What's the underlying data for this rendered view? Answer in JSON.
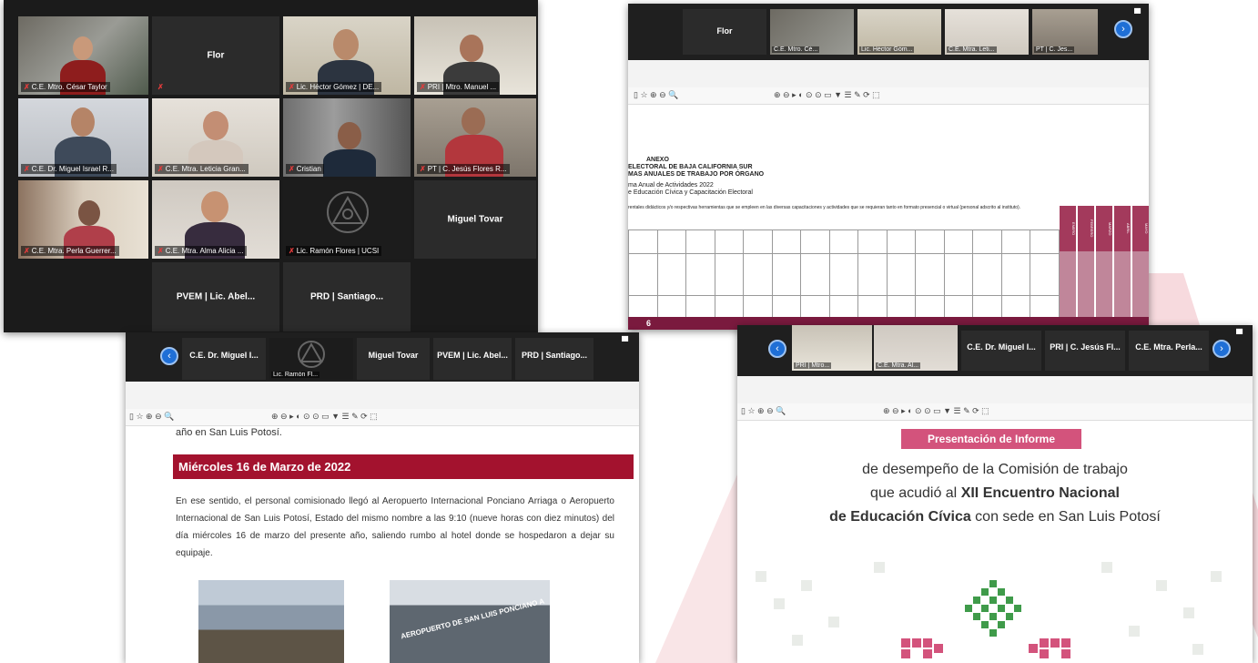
{
  "colors": {
    "brand_red": "#b8132d",
    "brand_pink": "#d3537c",
    "accent_blue": "#1f6fd6",
    "zoom_dark": "#1f1f1f"
  },
  "gallery": {
    "tiles": [
      {
        "label": "C.E. Mtro. César Taylor",
        "active": true
      },
      {
        "center_name": "Flor"
      },
      {
        "label": "Lic. Héctor Gómez | DE..."
      },
      {
        "label": "PRI | Mtro. Manuel ..."
      },
      {
        "label": "C.E. Dr. Miguel Israel R...",
        "active": true
      },
      {
        "label": "C.E. Mtra. Leticia Gran..."
      },
      {
        "label": "Cristian"
      },
      {
        "label": "PT | C. Jesús Flores R..."
      },
      {
        "label": "C.E. Mtra. Perla Guerrer..."
      },
      {
        "label": "C.E. Mtra. Alma Alicia ..."
      },
      {
        "label": "Lic. Ramón Flores | UCSI"
      },
      {
        "center_name": "Miguel Tovar"
      },
      {
        "center_name": "PVEM | Lic. Abel..."
      },
      {
        "center_name": "PRD | Santiago..."
      }
    ]
  },
  "shot2": {
    "strip": {
      "flor": "Flor",
      "t1": "C.E. Mtro. Cé...",
      "t2": "Lic. Héctor Góm...",
      "t3": "C.E. Mtra. Leti...",
      "t4": "PT | C. Jes..."
    },
    "annex": {
      "line1": "ANEXO",
      "line2": "ELECTORAL DE BAJA CALIFORNIA SUR",
      "line3": "MAS ANUALES DE TRABAJO POR ÓRGANO",
      "line4": "ma Anual de Actividades 2022",
      "line5": "e Educación Cívica y Capacitación Electoral",
      "line6": "rentales didácticos y/o respectivas herramientas que se empleen en las diversas capacitaciones y actividades que se requieran tanto en formato presencial o virtual (personal adscrito al instituto)."
    },
    "months": [
      "ENERO",
      "FEBRERO",
      "MARZO",
      "ABRIL",
      "MAYO"
    ],
    "page_number": "6"
  },
  "shot3": {
    "strip": {
      "t1": "C.E. Dr. Miguel I...",
      "t2": "Lic. Ramón Fl...",
      "t3": "Miguel Tovar",
      "t4": "PVEM | Lic. Abel...",
      "t5": "PRD | Santiago..."
    },
    "prev_text": "año en San Luis Potosí.",
    "date_heading": "Miércoles 16 de Marzo de 2022",
    "paragraph": "En ese sentido, el personal comisionado llegó al Aeropuerto Internacional Ponciano Arriaga o Aeropuerto Internacional de San Luis Potosí, Estado del mismo nombre a las 9:10 (nueve horas con diez minutos) del día miércoles 16 de marzo del presente año, saliendo rumbo al hotel donde se hospedaron a dejar su equipaje.",
    "photo2_sign": "AEROPUERTO DE SAN LUIS PONCIANO A"
  },
  "shot4": {
    "strip": {
      "t1": "PRI | Mtro...",
      "t2": "C.E. Mtra. Al...",
      "t3": "C.E. Dr. Miguel I...",
      "t4": "PRI | C. Jesús Fl...",
      "t5": "C.E. Mtra. Perla..."
    },
    "badge": "Presentación de Informe",
    "line1": "de desempeño de la Comisión de trabajo",
    "line2_pre": "que acudió al ",
    "line2_bold": "XII Encuentro Nacional",
    "line3_bold": "de Educación Cívica",
    "line3_post": " con sede en San Luis Potosí"
  }
}
